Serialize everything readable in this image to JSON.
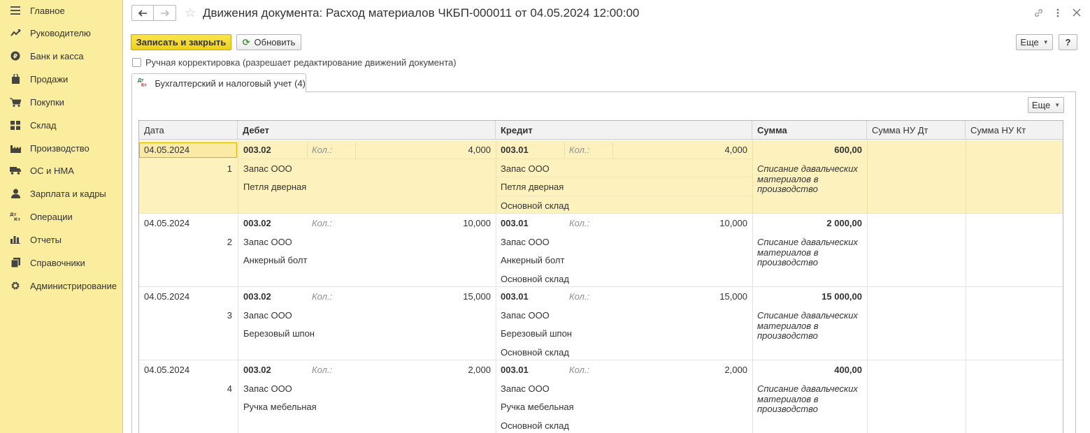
{
  "sidebar": {
    "items": [
      {
        "label": "Главное",
        "icon": "menu-icon"
      },
      {
        "label": "Руководителю",
        "icon": "trend-icon"
      },
      {
        "label": "Банк и касса",
        "icon": "coin-icon"
      },
      {
        "label": "Продажи",
        "icon": "bag-icon"
      },
      {
        "label": "Покупки",
        "icon": "cart-icon"
      },
      {
        "label": "Склад",
        "icon": "warehouse-icon"
      },
      {
        "label": "Производство",
        "icon": "factory-icon"
      },
      {
        "label": "ОС и НМА",
        "icon": "truck-icon"
      },
      {
        "label": "Зарплата и кадры",
        "icon": "person-icon"
      },
      {
        "label": "Операции",
        "icon": "dt-kt-icon"
      },
      {
        "label": "Отчеты",
        "icon": "bar-chart-icon"
      },
      {
        "label": "Справочники",
        "icon": "books-icon"
      },
      {
        "label": "Администрирование",
        "icon": "gear-icon"
      }
    ]
  },
  "header": {
    "title": "Движения документа: Расход материалов ЧКБП-000011 от 04.05.2024 12:00:00"
  },
  "toolbar": {
    "save_close": "Записать и закрыть",
    "refresh": "Обновить",
    "more": "Еще",
    "help": "?"
  },
  "manual": {
    "label": "Ручная корректировка (разрешает редактирование движений документа)",
    "checked": false
  },
  "tab": {
    "label": "Бухгалтерский и налоговый учет (4)",
    "icon_dt": "Дт",
    "icon_kt": "Кт"
  },
  "grid": {
    "more": "Еще",
    "columns": {
      "date": "Дата",
      "debit": "Дебет",
      "credit": "Кредит",
      "sum": "Сумма",
      "sum_nu_dt": "Сумма НУ Дт",
      "sum_nu_kt": "Сумма НУ Кт"
    },
    "rows": [
      {
        "date": "04.05.2024",
        "num": "1",
        "dt_acc": "003.02",
        "dt_qty_label": "Кол.:",
        "dt_qty": "4,000",
        "dt_sub1": "Запас ООО",
        "dt_sub2": "Петля дверная",
        "kt_acc": "003.01",
        "kt_qty_label": "Кол.:",
        "kt_qty": "4,000",
        "kt_sub1": "Запас ООО",
        "kt_sub2": "Петля дверная",
        "kt_sub3": "Основной склад",
        "sum": "600,00",
        "content": "Списание давальческих материалов в производство"
      },
      {
        "date": "04.05.2024",
        "num": "2",
        "dt_acc": "003.02",
        "dt_qty_label": "Кол.:",
        "dt_qty": "10,000",
        "dt_sub1": "Запас ООО",
        "dt_sub2": "Анкерный болт",
        "kt_acc": "003.01",
        "kt_qty_label": "Кол.:",
        "kt_qty": "10,000",
        "kt_sub1": "Запас ООО",
        "kt_sub2": "Анкерный болт",
        "kt_sub3": "Основной склад",
        "sum": "2 000,00",
        "content": "Списание давальческих материалов в производство"
      },
      {
        "date": "04.05.2024",
        "num": "3",
        "dt_acc": "003.02",
        "dt_qty_label": "Кол.:",
        "dt_qty": "15,000",
        "dt_sub1": "Запас ООО",
        "dt_sub2": "Березовый шпон",
        "kt_acc": "003.01",
        "kt_qty_label": "Кол.:",
        "kt_qty": "15,000",
        "kt_sub1": "Запас ООО",
        "kt_sub2": "Березовый шпон",
        "kt_sub3": "Основной склад",
        "sum": "15 000,00",
        "content": "Списание давальческих материалов в производство"
      },
      {
        "date": "04.05.2024",
        "num": "4",
        "dt_acc": "003.02",
        "dt_qty_label": "Кол.:",
        "dt_qty": "2,000",
        "dt_sub1": "Запас ООО",
        "dt_sub2": "Ручка мебельная",
        "kt_acc": "003.01",
        "kt_qty_label": "Кол.:",
        "kt_qty": "2,000",
        "kt_sub1": "Запас ООО",
        "kt_sub2": "Ручка мебельная",
        "kt_sub3": "Основной склад",
        "sum": "400,00",
        "content": "Списание давальческих материалов в производство"
      }
    ]
  }
}
